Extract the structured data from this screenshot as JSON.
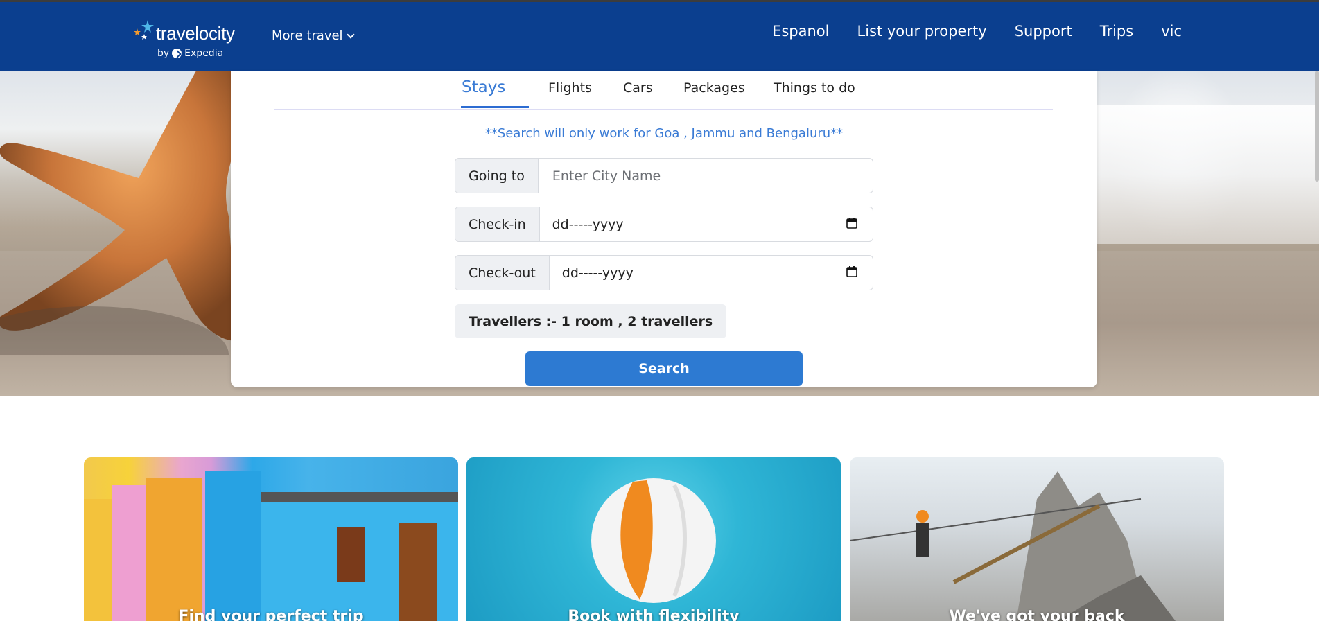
{
  "header": {
    "logo_text": "travelocity",
    "logo_sub_by": "by",
    "logo_sub_brand": "Expedia",
    "more_travel": "More travel",
    "nav": [
      "Espanol",
      "List your property",
      "Support",
      "Trips",
      "vic"
    ]
  },
  "search": {
    "tabs": [
      "Stays",
      "Flights",
      "Cars",
      "Packages",
      "Things to do"
    ],
    "active_tab": "Stays",
    "notice": "**Search will only work for Goa , Jammu and Bengaluru**",
    "going_to": {
      "label": "Going to",
      "placeholder": "Enter City Name"
    },
    "check_in": {
      "label": "Check-in",
      "value": "dd-----yyyy"
    },
    "check_out": {
      "label": "Check-out",
      "value": "dd-----yyyy"
    },
    "travellers": "Travellers :- 1 room , 2 travellers",
    "button": "Search"
  },
  "promos": [
    {
      "title": "Find your perfect trip"
    },
    {
      "title": "Book with flexibility"
    },
    {
      "title": "We've got your back"
    }
  ],
  "colors": {
    "header_bg": "#0b3f8f",
    "accent": "#3a7bd5",
    "button": "#2d7ad2"
  }
}
